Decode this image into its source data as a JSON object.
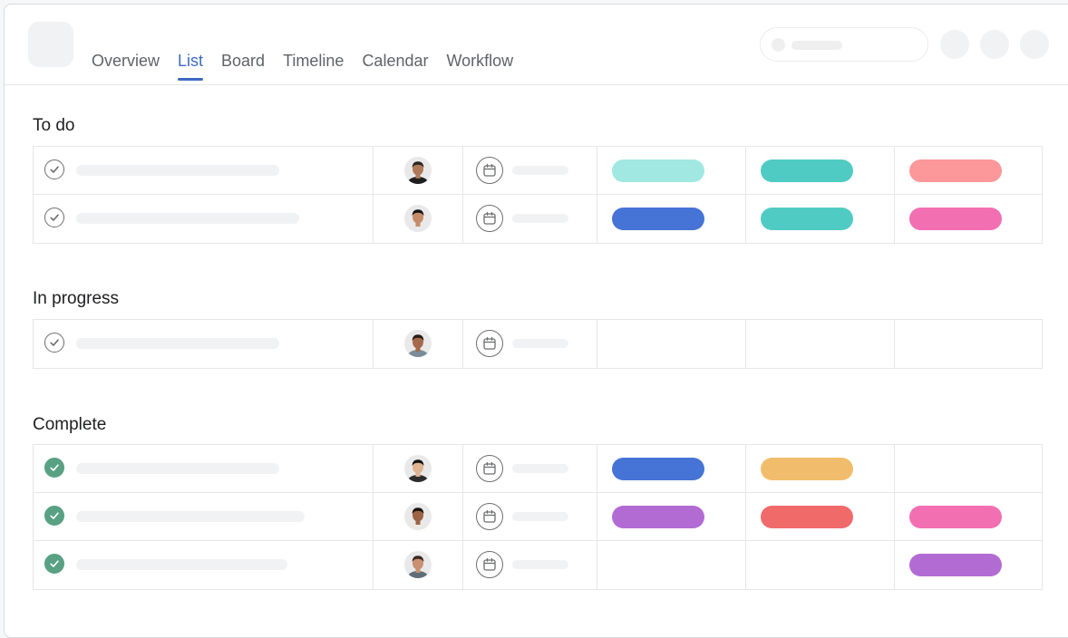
{
  "tabs": [
    {
      "label": "Overview",
      "active": false
    },
    {
      "label": "List",
      "active": true
    },
    {
      "label": "Board",
      "active": false
    },
    {
      "label": "Timeline",
      "active": false
    },
    {
      "label": "Calendar",
      "active": false
    },
    {
      "label": "Workflow",
      "active": false
    }
  ],
  "sections": [
    {
      "title": "To do",
      "rows": [
        {
          "completed": false,
          "assignee": "avatar-man-beard",
          "tags": [
            "#a1e8e2",
            "#4fcbc4",
            "#fc979a"
          ]
        },
        {
          "completed": false,
          "assignee": "avatar-woman-dark-hair",
          "tags": [
            "#4673d6",
            "#4fcbc4",
            "#f26fb2"
          ]
        }
      ]
    },
    {
      "title": "In progress",
      "rows": [
        {
          "completed": false,
          "assignee": "avatar-man-smiling",
          "tags": []
        }
      ]
    },
    {
      "title": "Complete",
      "rows": [
        {
          "completed": true,
          "assignee": "avatar-woman-short-hair",
          "tags": [
            "#4673d6",
            "#f1bd6c"
          ]
        },
        {
          "completed": true,
          "assignee": "avatar-woman-long-hair",
          "tags": [
            "#b36bd4",
            "#f06a6a",
            "#f26fb2"
          ]
        },
        {
          "completed": true,
          "assignee": "avatar-man-glasses",
          "tags": [
            null,
            null,
            "#b36bd4"
          ]
        }
      ]
    }
  ],
  "colors": {
    "accent": "#3f6ac4",
    "complete_check": "#58a182"
  }
}
